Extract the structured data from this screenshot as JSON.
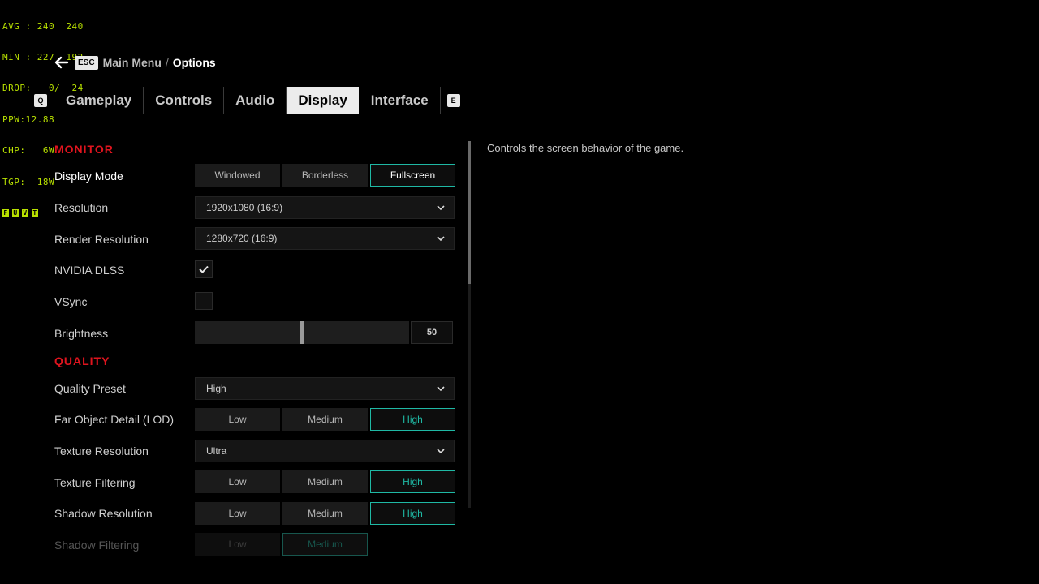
{
  "perf_overlay": {
    "lines": [
      "AVG : 240  240",
      "MIN : 227  192",
      "DROP:   0/  24",
      "PPW:12.88",
      "CHP:   6W",
      "TGP:  18W"
    ],
    "indicators": [
      "F",
      "U",
      "V",
      "T"
    ],
    "color": "#b8e000"
  },
  "breadcrumb": {
    "back_icon": "arrow-left-icon",
    "key": "ESC",
    "parent": "Main Menu",
    "separator": "/",
    "current": "Options"
  },
  "tabs": {
    "prev_key": "Q",
    "next_key": "E",
    "items": [
      {
        "label": "Gameplay",
        "active": false
      },
      {
        "label": "Controls",
        "active": false
      },
      {
        "label": "Audio",
        "active": false
      },
      {
        "label": "Display",
        "active": true
      },
      {
        "label": "Interface",
        "active": false
      }
    ]
  },
  "sections": {
    "monitor": "MONITOR",
    "quality": "QUALITY"
  },
  "settings": {
    "display_mode": {
      "label": "Display Mode",
      "options": [
        "Windowed",
        "Borderless",
        "Fullscreen"
      ],
      "selected": "Fullscreen"
    },
    "resolution": {
      "label": "Resolution",
      "value": "1920x1080 (16:9)"
    },
    "render_resolution": {
      "label": "Render Resolution",
      "value": "1280x720 (16:9)"
    },
    "dlss": {
      "label": "NVIDIA DLSS",
      "checked": true
    },
    "vsync": {
      "label": "VSync",
      "checked": false
    },
    "brightness": {
      "label": "Brightness",
      "value": "50",
      "fraction": 0.5
    },
    "quality_preset": {
      "label": "Quality Preset",
      "value": "High"
    },
    "far_object_detail": {
      "label": "Far Object Detail (LOD)",
      "options": [
        "Low",
        "Medium",
        "High"
      ],
      "selected": "High"
    },
    "texture_resolution": {
      "label": "Texture Resolution",
      "value": "Ultra"
    },
    "texture_filtering": {
      "label": "Texture Filtering",
      "options": [
        "Low",
        "Medium",
        "High"
      ],
      "selected": "High"
    },
    "shadow_resolution": {
      "label": "Shadow Resolution",
      "options": [
        "Low",
        "Medium",
        "High"
      ],
      "selected": "High"
    },
    "shadow_filtering": {
      "label": "Shadow Filtering",
      "options": [
        "Low",
        "Medium"
      ],
      "selected": "Medium"
    }
  },
  "description": "Controls the screen behavior of the game.",
  "colors": {
    "accent": "#1fb8a4",
    "section": "#e0141e",
    "tab_active_bg": "#ececec"
  }
}
